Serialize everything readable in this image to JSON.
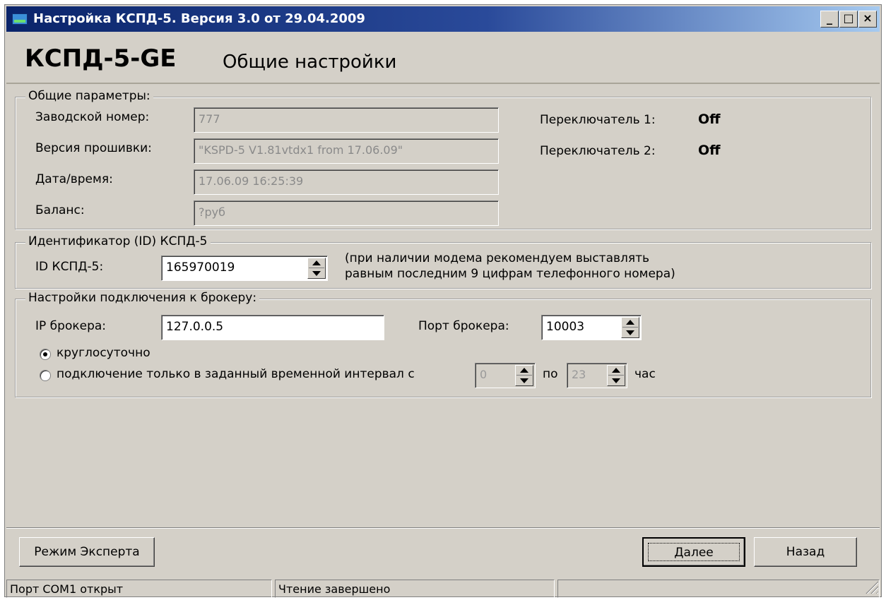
{
  "window": {
    "title": "Настройка КСПД-5. Версия 3.0 от 29.04.2009",
    "controls": {
      "minimize": "_",
      "maximize": "□",
      "close": "×"
    }
  },
  "header": {
    "product": "КСПД-5-GE",
    "section": "Общие настройки"
  },
  "general": {
    "legend": "Общие параметры:",
    "serial_label": "Заводской номер:",
    "serial_value": "777",
    "firmware_label": "Версия прошивки:",
    "firmware_value": "\"KSPD-5 V1.81vtdx1 from 17.06.09\"",
    "datetime_label": "Дата/время:",
    "datetime_value": "17.06.09 16:25:39",
    "balance_label": "Баланс:",
    "balance_value": "?руб",
    "switch1_label": "Переключатель 1:",
    "switch1_value": "Off",
    "switch2_label": "Переключатель 2:",
    "switch2_value": "Off"
  },
  "identifier": {
    "legend": "Идентификатор (ID) КСПД-5",
    "id_label": "ID КСПД-5:",
    "id_value": "165970019",
    "hint_line1": "(при наличии модема рекомендуем выставлять",
    "hint_line2": "равным последним 9 цифрам телефонного номера)"
  },
  "broker": {
    "legend": "Настройки подключения к брокеру:",
    "ip_label": "IP брокера:",
    "ip_value": "127.0.0.5",
    "port_label": "Порт брокера:",
    "port_value": "10003",
    "radio_always": "круглосуточно",
    "radio_always_selected": true,
    "radio_interval": "подключение только в заданный временной интервал с",
    "from_value": "0",
    "to_label": "по",
    "to_value": "23",
    "hour_label": "час"
  },
  "buttons": {
    "expert": "Режим Эксперта",
    "next": "Далее",
    "back": "Назад"
  },
  "statusbar": {
    "port": "Порт COM1 открыт",
    "read": "Чтение завершено",
    "extra": ""
  }
}
